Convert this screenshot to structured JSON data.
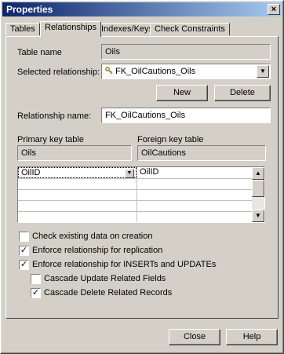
{
  "window": {
    "title": "Properties",
    "close_glyph": "×"
  },
  "tabs": [
    {
      "label": "Tables",
      "active": false
    },
    {
      "label": "Relationships",
      "active": true
    },
    {
      "label": "Indexes/Keys",
      "active": false
    },
    {
      "label": "Check Constraints",
      "active": false
    }
  ],
  "form": {
    "table_name_label": "Table name",
    "table_name_value": "Oils",
    "selected_relationship_label": "Selected relationship:",
    "selected_relationship_value": "FK_OilCautions_Oils",
    "new_button": "New",
    "delete_button": "Delete",
    "relationship_name_label": "Relationship name:",
    "relationship_name_value": "FK_OilCautions_Oils",
    "primary_key_table_label": "Primary key table",
    "primary_key_table_value": "Oils",
    "foreign_key_table_label": "Foreign key table",
    "foreign_key_table_value": "OilCautions"
  },
  "key_grid": {
    "rows": [
      {
        "primary": "OilID",
        "foreign": "OilID"
      },
      {
        "primary": "",
        "foreign": ""
      },
      {
        "primary": "",
        "foreign": ""
      },
      {
        "primary": "",
        "foreign": ""
      },
      {
        "primary": "",
        "foreign": ""
      }
    ]
  },
  "options": [
    {
      "label": "Check existing data on creation",
      "checked": false
    },
    {
      "label": "Enforce relationship for replication",
      "checked": true
    },
    {
      "label": "Enforce relationship for INSERTs and UPDATEs",
      "checked": true
    },
    {
      "label": "Cascade Update Related Fields",
      "checked": false
    },
    {
      "label": "Cascade Delete Related Records",
      "checked": true
    }
  ],
  "footer": {
    "close_button": "Close",
    "help_button": "Help"
  }
}
